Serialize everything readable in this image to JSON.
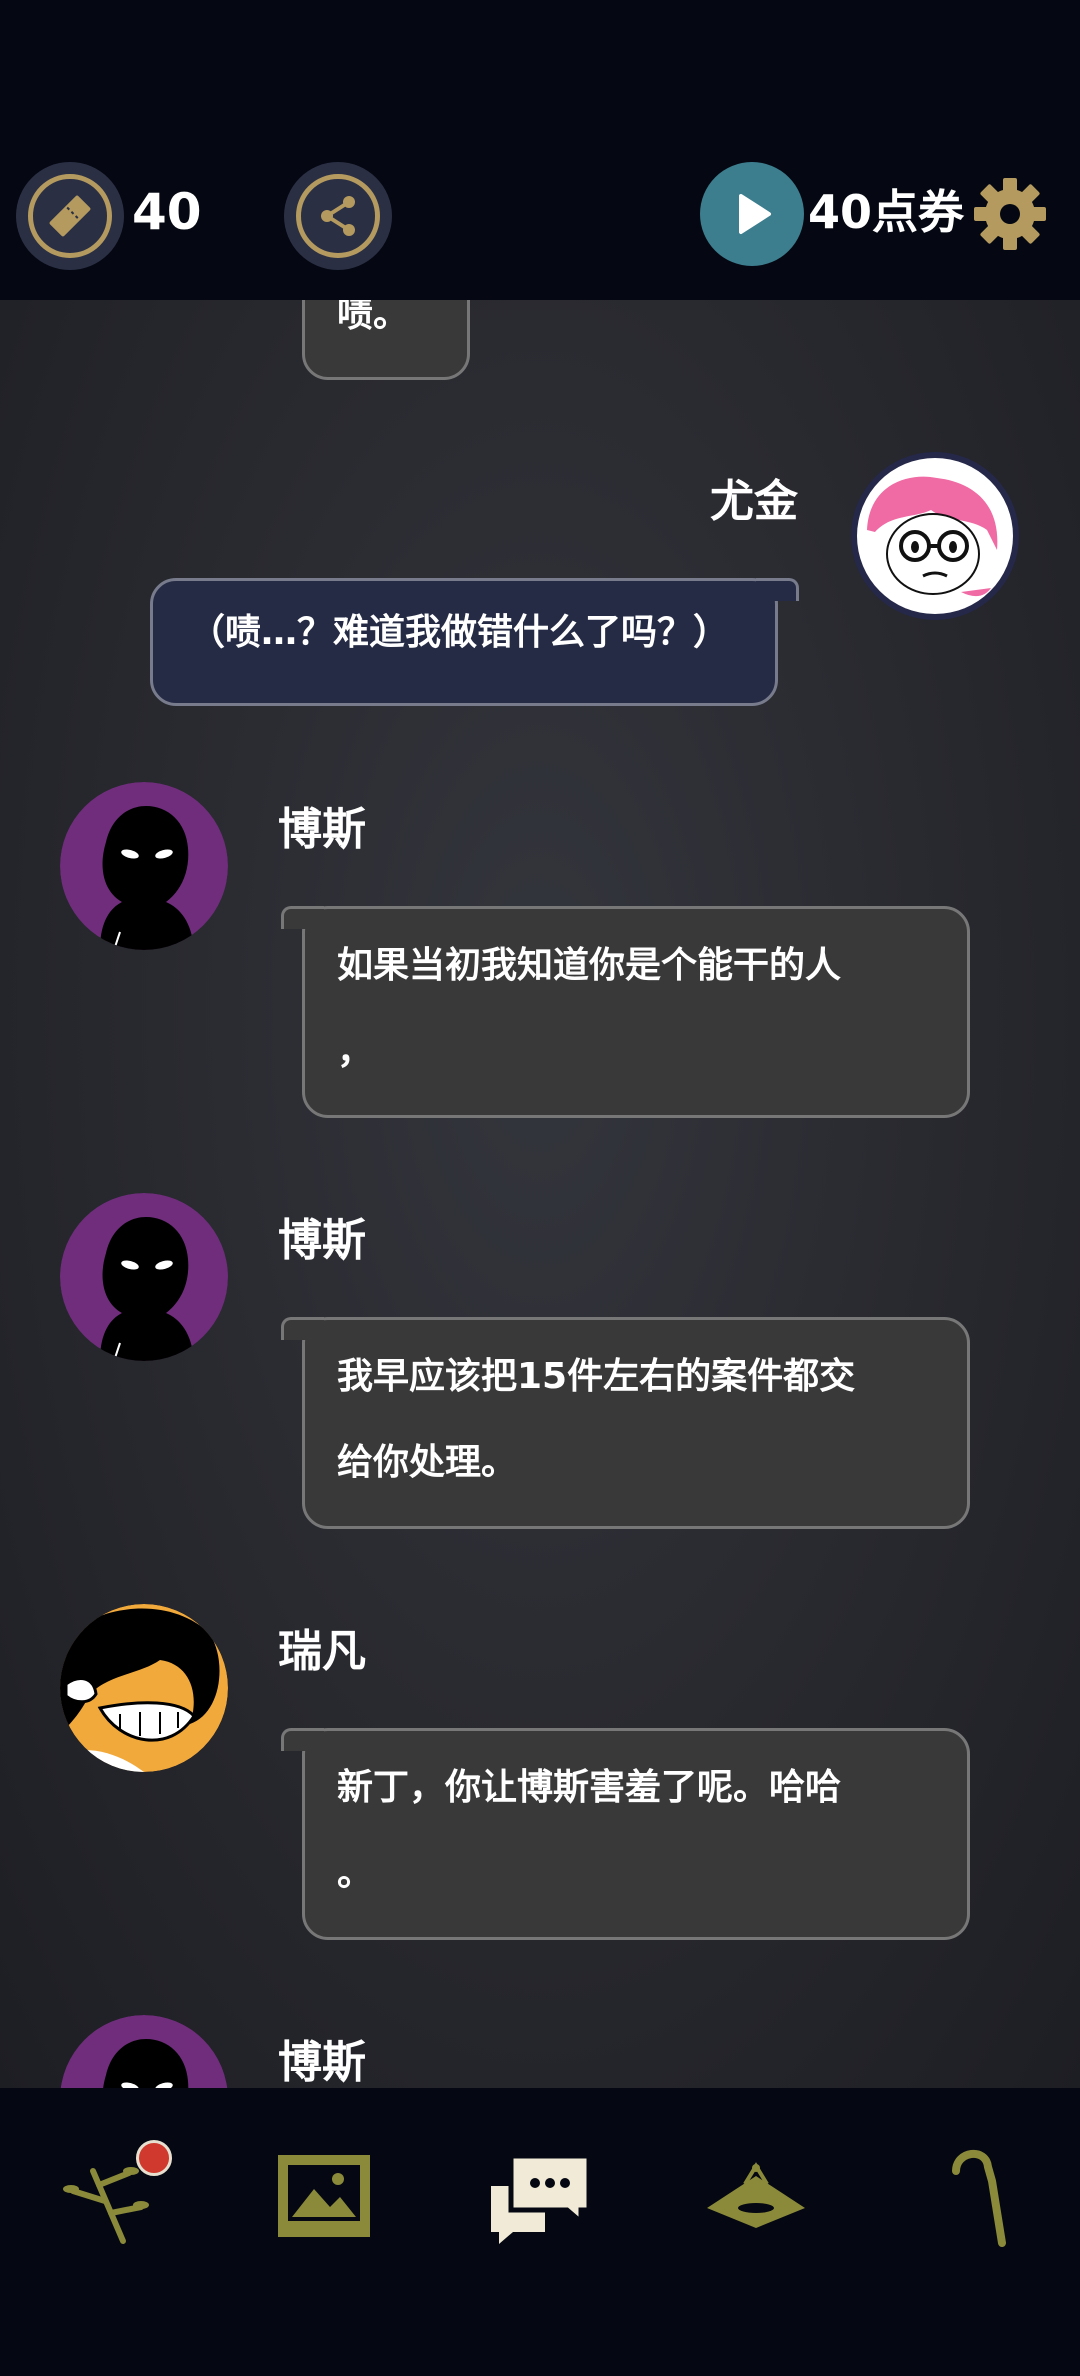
{
  "top_bar": {
    "ticket_count": "40",
    "ticket_icon": "ticket-icon",
    "share_icon": "share-icon",
    "play_icon": "play-icon",
    "coupon_text": "40点券",
    "settings_icon": "gear-icon",
    "accent": "#b49a5f"
  },
  "chat": {
    "partial_message": "啧。",
    "messages": [
      {
        "speaker": "尤金",
        "text": "（啧…？难道我做错什么了吗？）",
        "side": "right"
      },
      {
        "speaker": "博斯",
        "lines": [
          "如果当初我知道你是个能干的人",
          "，"
        ],
        "side": "left"
      },
      {
        "speaker": "博斯",
        "lines": [
          "我早应该把15件左右的案件都交",
          "给你处理。"
        ],
        "side": "left"
      },
      {
        "speaker": "瑞凡",
        "lines": [
          "新丁，你让博斯害羞了呢。哈哈",
          "。"
        ],
        "side": "left"
      },
      {
        "speaker": "博斯",
        "side": "left"
      }
    ]
  },
  "bottom_nav": {
    "items": [
      "branch-icon",
      "gallery-icon",
      "chat-icon",
      "hat-icon",
      "cane-icon"
    ],
    "badge_color": "#d0392d"
  }
}
